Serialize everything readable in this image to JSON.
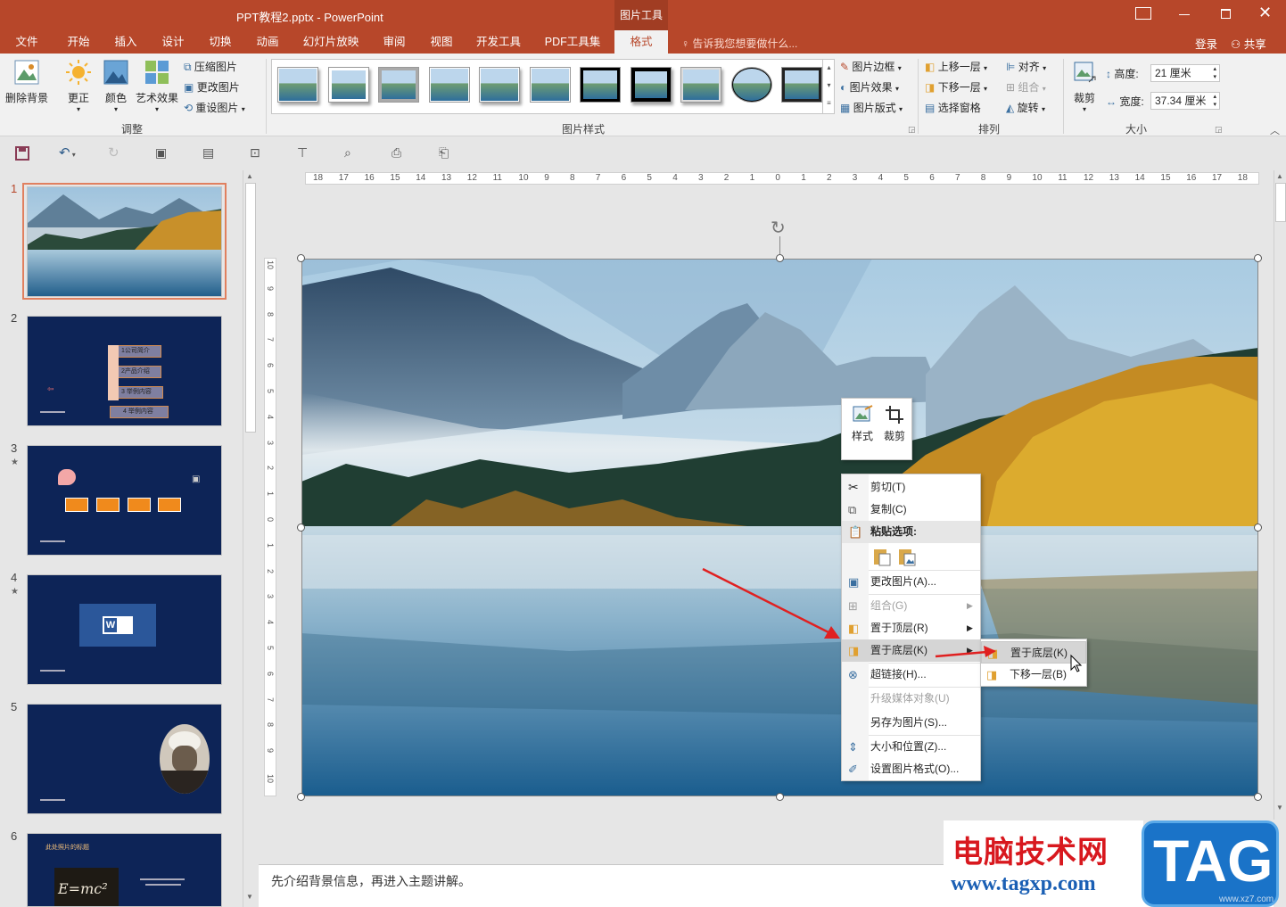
{
  "window": {
    "title": "PPT教程2.pptx - PowerPoint",
    "context_tab_group": "图片工具",
    "signin": "登录",
    "share": "共享"
  },
  "tabs": [
    "文件",
    "开始",
    "插入",
    "设计",
    "切换",
    "动画",
    "幻灯片放映",
    "审阅",
    "视图",
    "开发工具",
    "PDF工具集",
    "格式"
  ],
  "active_tab": "格式",
  "tell_me": "告诉我您想要做什么...",
  "ribbon": {
    "remove_bg": "删除背景",
    "corrections": "更正",
    "color": "颜色",
    "artistic": "艺术效果",
    "compress": "压缩图片",
    "change_pic": "更改图片",
    "reset_pic": "重设图片",
    "group_adjust": "调整",
    "group_styles": "图片样式",
    "pic_border": "图片边框",
    "pic_effects": "图片效果",
    "pic_layout": "图片版式",
    "bring_forward": "上移一层",
    "send_backward": "下移一层",
    "selection_pane": "选择窗格",
    "align": "对齐",
    "group": "组合",
    "rotate": "旋转",
    "group_arrange": "排列",
    "crop": "裁剪",
    "height_label": "高度:",
    "height_value": "21 厘米",
    "width_label": "宽度:",
    "width_value": "37.34 厘米",
    "group_size": "大小"
  },
  "slides": [
    {
      "num": "1",
      "star": ""
    },
    {
      "num": "2",
      "star": "",
      "items": [
        "1公司简介",
        "2产品介绍",
        "3 举例内容",
        "4 举例内容"
      ]
    },
    {
      "num": "3",
      "star": "★"
    },
    {
      "num": "4",
      "star": "★"
    },
    {
      "num": "5",
      "star": ""
    },
    {
      "num": "6",
      "star": "",
      "title": "此处照片的标题",
      "formula": "E=mc²"
    }
  ],
  "ruler_h": [
    "18",
    "17",
    "16",
    "15",
    "14",
    "13",
    "12",
    "11",
    "10",
    "9",
    "8",
    "7",
    "6",
    "5",
    "4",
    "3",
    "2",
    "1",
    "0",
    "1",
    "2",
    "3",
    "4",
    "5",
    "6",
    "7",
    "8",
    "9",
    "10",
    "11",
    "12",
    "13",
    "14",
    "15",
    "16",
    "17",
    "18"
  ],
  "ruler_v": [
    "10",
    "9",
    "8",
    "7",
    "6",
    "5",
    "4",
    "3",
    "2",
    "1",
    "0",
    "1",
    "2",
    "3",
    "4",
    "5",
    "6",
    "7",
    "8",
    "9",
    "10"
  ],
  "mini_toolbar": {
    "style": "样式",
    "crop": "裁剪"
  },
  "context_menu": [
    {
      "label": "剪切(T)",
      "icon": "scissors-icon",
      "enabled": true
    },
    {
      "label": "复制(C)",
      "icon": "copy-icon",
      "enabled": true
    },
    {
      "label": "粘贴选项:",
      "icon": "paste-icon",
      "enabled": true
    },
    {
      "label": "更改图片(A)...",
      "icon": "change-picture-icon",
      "enabled": true
    },
    {
      "label": "组合(G)",
      "icon": "group-icon",
      "enabled": false
    },
    {
      "label": "置于顶层(R)",
      "icon": "bring-to-front-icon",
      "enabled": true
    },
    {
      "label": "置于底层(K)",
      "icon": "send-to-back-icon",
      "enabled": true
    },
    {
      "label": "超链接(H)...",
      "icon": "hyperlink-icon",
      "enabled": true
    },
    {
      "label": "升级媒体对象(U)",
      "icon": "",
      "enabled": false
    },
    {
      "label": "另存为图片(S)...",
      "icon": "",
      "enabled": true
    },
    {
      "label": "大小和位置(Z)...",
      "icon": "size-position-icon",
      "enabled": true
    },
    {
      "label": "设置图片格式(O)...",
      "icon": "format-picture-icon",
      "enabled": true
    }
  ],
  "submenu": [
    {
      "label": "置于底层(K)",
      "icon": "send-to-back-icon"
    },
    {
      "label": "下移一层(B)",
      "icon": "send-backward-icon"
    }
  ],
  "notes": "先介绍背景信息，再进入主题讲解。",
  "watermark": {
    "title": "电脑技术网",
    "url": "www.tagxp.com",
    "tag": "TAG",
    "small": "www.xz7.com"
  },
  "colors": {
    "accent": "#b7472a",
    "slide_bg": "#0d2457"
  }
}
